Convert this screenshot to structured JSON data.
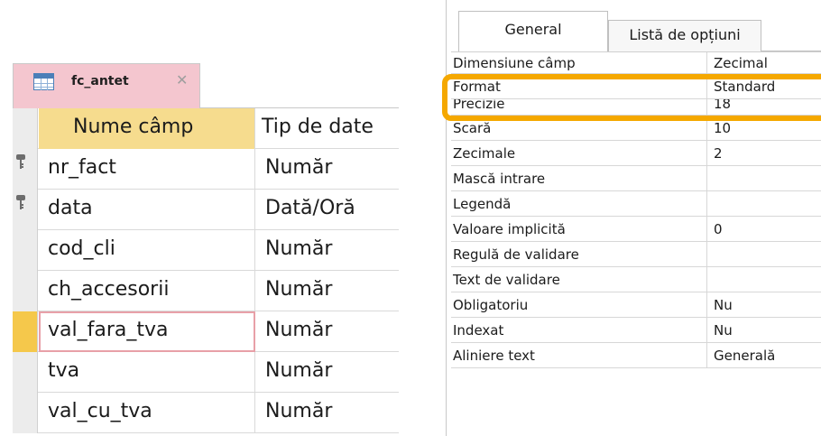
{
  "table_design": {
    "tab": {
      "title": "fc_antet",
      "close_glyph": "✕",
      "icon": "table-icon"
    },
    "columns": [
      "Nume câmp",
      "Tip de date"
    ],
    "rows": [
      {
        "field": "nr_fact",
        "type": "Număr",
        "primary_key": true
      },
      {
        "field": "data",
        "type": "Dată/Oră",
        "primary_key": true
      },
      {
        "field": "cod_cli",
        "type": "Număr",
        "primary_key": false
      },
      {
        "field": "ch_accesorii",
        "type": "Număr",
        "primary_key": false
      },
      {
        "field": "val_fara_tva",
        "type": "Număr",
        "primary_key": false,
        "current": true
      },
      {
        "field": "tva",
        "type": "Număr",
        "primary_key": false
      },
      {
        "field": "val_cu_tva",
        "type": "Număr",
        "primary_key": false
      }
    ]
  },
  "field_properties": {
    "tabs": [
      "General",
      "Listă de opțiuni"
    ],
    "active_tab": "General",
    "rows": [
      {
        "name": "Dimensiune câmp",
        "value": "Zecimal"
      },
      {
        "name": "Format",
        "value": "Standard"
      },
      {
        "name": "Precizie",
        "value": "18"
      },
      {
        "name": "Scară",
        "value": "10"
      },
      {
        "name": "Zecimale",
        "value": "2"
      },
      {
        "name": "Mască intrare",
        "value": ""
      },
      {
        "name": "Legendă",
        "value": ""
      },
      {
        "name": "Valoare implicită",
        "value": "0"
      },
      {
        "name": "Regulă de validare",
        "value": ""
      },
      {
        "name": "Text de validare",
        "value": ""
      },
      {
        "name": "Obligatoriu",
        "value": "Nu"
      },
      {
        "name": "Indexat",
        "value": "Nu"
      },
      {
        "name": "Aliniere text",
        "value": "Generală"
      }
    ]
  },
  "colors": {
    "tab_pink": "#f4c6cf",
    "header_yellow": "#f6dc8e",
    "current_row_selector": "#f5c84b",
    "highlight_orange": "#f5a800"
  }
}
